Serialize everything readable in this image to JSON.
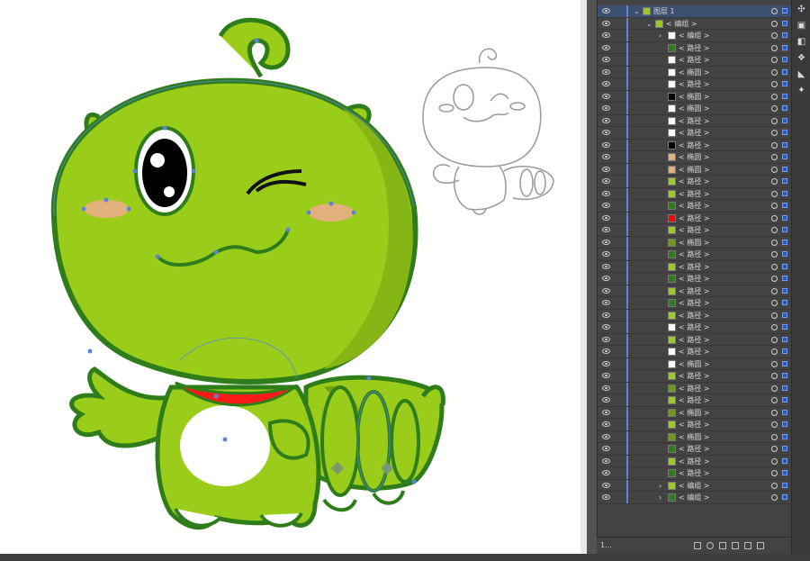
{
  "layers_panel": {
    "rows": [
      {
        "label": "图层 1",
        "indent": 0,
        "arrow": "expanded",
        "thumb": "#9acd1a",
        "kind": "layer"
      },
      {
        "label": "< 编组 >",
        "indent": 1,
        "arrow": "expanded",
        "thumb": "#9acd1a"
      },
      {
        "label": "< 编组 >",
        "indent": 2,
        "arrow": "collapsed",
        "thumb": "#ffffff"
      },
      {
        "label": "< 路径 >",
        "indent": 2,
        "thumb": "#2e7d1a"
      },
      {
        "label": "< 路径 >",
        "indent": 2,
        "thumb": "#ffffff"
      },
      {
        "label": "< 椭圆 >",
        "indent": 2,
        "thumb": "#ffffff"
      },
      {
        "label": "< 路径 >",
        "indent": 2,
        "thumb": "#ffffff"
      },
      {
        "label": "< 椭圆 >",
        "indent": 2,
        "thumb": "#000000"
      },
      {
        "label": "< 椭圆 >",
        "indent": 2,
        "thumb": "#ffffff"
      },
      {
        "label": "< 路径 >",
        "indent": 2,
        "thumb": "#ffffff"
      },
      {
        "label": "< 路径 >",
        "indent": 2,
        "thumb": "#ffffff"
      },
      {
        "label": "< 路径 >",
        "indent": 2,
        "thumb": "#000000"
      },
      {
        "label": "< 椭圆 >",
        "indent": 2,
        "thumb": "#e2b07a"
      },
      {
        "label": "< 椭圆 >",
        "indent": 2,
        "thumb": "#e2b07a"
      },
      {
        "label": "< 路径 >",
        "indent": 2,
        "thumb": "#9acd1a"
      },
      {
        "label": "< 路径 >",
        "indent": 2,
        "thumb": "#9acd1a"
      },
      {
        "label": "< 路径 >",
        "indent": 2,
        "thumb": "#2e7d1a"
      },
      {
        "label": "< 路径 >",
        "indent": 2,
        "thumb": "#ff0000"
      },
      {
        "label": "< 路径 >",
        "indent": 2,
        "thumb": "#9acd1a"
      },
      {
        "label": "< 椭圆 >",
        "indent": 2,
        "thumb": "#6d9b0e"
      },
      {
        "label": "< 路径 >",
        "indent": 2,
        "thumb": "#2e7d1a"
      },
      {
        "label": "< 路径 >",
        "indent": 2,
        "thumb": "#9acd1a"
      },
      {
        "label": "< 路径 >",
        "indent": 2,
        "thumb": "#2e7d1a"
      },
      {
        "label": "< 路径 >",
        "indent": 2,
        "thumb": "#9acd1a"
      },
      {
        "label": "< 路径 >",
        "indent": 2,
        "thumb": "#2e7d1a"
      },
      {
        "label": "< 路径 >",
        "indent": 2,
        "thumb": "#9acd1a"
      },
      {
        "label": "< 路径 >",
        "indent": 2,
        "thumb": "#ffffff"
      },
      {
        "label": "< 路径 >",
        "indent": 2,
        "thumb": "#9acd1a"
      },
      {
        "label": "< 路径 >",
        "indent": 2,
        "thumb": "#ffffff"
      },
      {
        "label": "< 椭圆 >",
        "indent": 2,
        "thumb": "#ffffff"
      },
      {
        "label": "< 路径 >",
        "indent": 2,
        "thumb": "#9acd1a"
      },
      {
        "label": "< 路径 >",
        "indent": 2,
        "thumb": "#6d9b0e"
      },
      {
        "label": "< 路径 >",
        "indent": 2,
        "thumb": "#9acd1a"
      },
      {
        "label": "< 椭圆 >",
        "indent": 2,
        "thumb": "#6d9b0e"
      },
      {
        "label": "< 路径 >",
        "indent": 2,
        "thumb": "#9acd1a"
      },
      {
        "label": "< 椭圆 >",
        "indent": 2,
        "thumb": "#6d9b0e"
      },
      {
        "label": "< 路径 >",
        "indent": 2,
        "thumb": "#2e7d1a"
      },
      {
        "label": "< 路径 >",
        "indent": 2,
        "thumb": "#9acd1a"
      },
      {
        "label": "< 路径 >",
        "indent": 2,
        "thumb": "#2e7d1a"
      },
      {
        "label": "< 编组 >",
        "indent": 2,
        "arrow": "collapsed",
        "thumb": "#9acd1a"
      },
      {
        "label": "< 编组 >",
        "indent": 2,
        "arrow": "collapsed",
        "thumb": "#2e7d1a"
      }
    ],
    "footer_count": "1..."
  },
  "colors": {
    "body_green": "#9acd1a",
    "outline_green": "#2e7d1a",
    "shadow_green": "#86b516",
    "collar_red": "#ff1a1a",
    "cheek": "#e2b07a",
    "panel_bg": "#434343",
    "selection_blue": "#5b86d8"
  },
  "tool_icons": [
    "transform-icon",
    "layers-icon",
    "appearance-icon",
    "shapes-icon",
    "brush-icon",
    "magic-wand-icon"
  ]
}
